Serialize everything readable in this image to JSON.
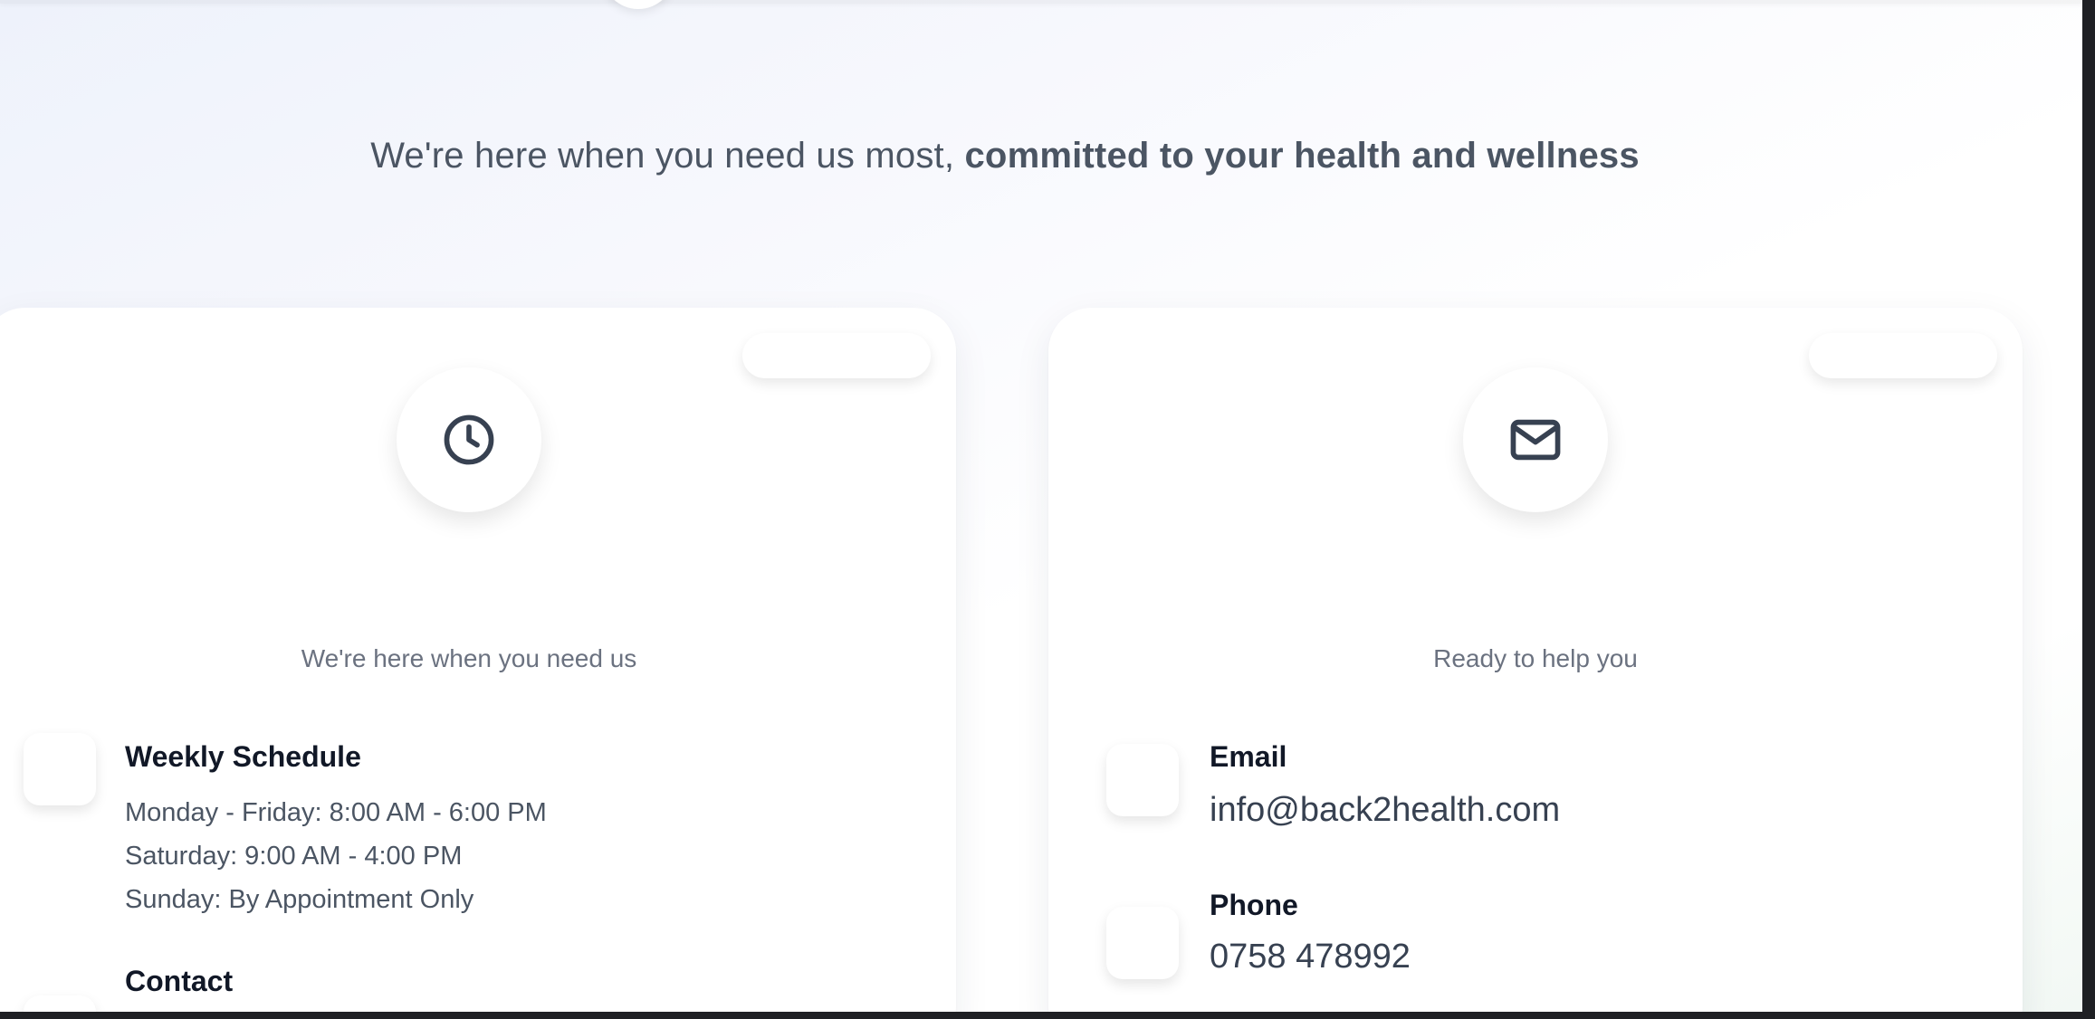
{
  "hero": {
    "tagline_regular": "We're here when you need us most, ",
    "tagline_bold": "committed to your health and wellness"
  },
  "hours_card": {
    "icon": "clock-icon",
    "subtitle": "We're here when you need us",
    "schedule": {
      "heading": "Weekly Schedule",
      "lines": [
        "Monday - Friday: 8:00 AM - 6:00 PM",
        "Saturday: 9:00 AM - 4:00 PM",
        "Sunday: By Appointment Only"
      ]
    },
    "contact": {
      "heading": "Contact"
    }
  },
  "contact_card": {
    "icon": "mail-icon",
    "subtitle": "Ready to help you",
    "email": {
      "heading": "Email",
      "value": "info@back2health.com"
    },
    "phone": {
      "heading": "Phone",
      "value": "0758 478992"
    }
  },
  "colors": {
    "heading": "#111827",
    "body_text": "#4b5563",
    "muted_text": "#6b7280",
    "icon_stroke": "#374151"
  }
}
